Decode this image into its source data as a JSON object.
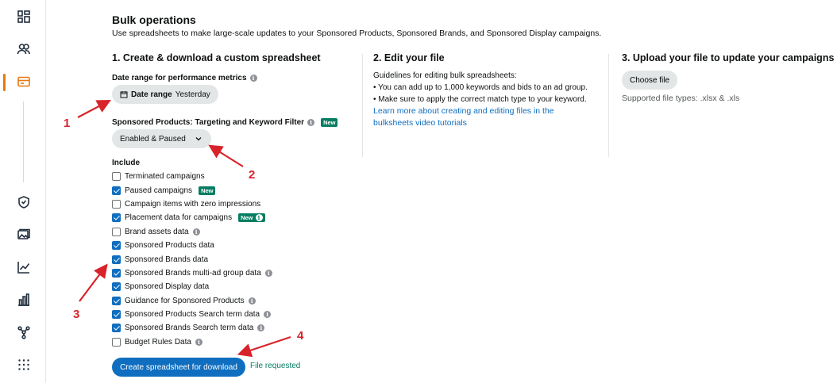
{
  "sidebar": {
    "icons": [
      "dashboard-icon",
      "audiences-icon",
      "campaigns-icon",
      "brand-safety-icon",
      "media-icon",
      "reports-icon",
      "measurement-icon",
      "integrations-icon",
      "apps-grid-icon"
    ],
    "active_index": 2,
    "accent_color": "#e47911"
  },
  "header": {
    "title": "Bulk operations",
    "subtitle": "Use spreadsheets to make large-scale updates to your Sponsored Products, Sponsored Brands, and Sponsored Display campaigns."
  },
  "step1": {
    "title": "1. Create & download a custom spreadsheet",
    "date_range_label": "Date range for performance metrics",
    "date_range_button_bold": "Date range",
    "date_range_value": "Yesterday",
    "filter_label": "Sponsored Products: Targeting and Keyword Filter",
    "filter_badge": "New",
    "filter_value": "Enabled & Paused",
    "include_title": "Include",
    "include_items": [
      {
        "label": "Terminated campaigns",
        "checked": false,
        "badge": "",
        "info": false
      },
      {
        "label": "Paused campaigns",
        "checked": true,
        "badge": "New",
        "info": false
      },
      {
        "label": "Campaign items with zero impressions",
        "checked": false,
        "badge": "",
        "info": false
      },
      {
        "label": "Placement data for campaigns",
        "checked": true,
        "badge": "New",
        "info": true
      },
      {
        "label": "Brand assets data",
        "checked": false,
        "badge": "",
        "info": true
      },
      {
        "label": "Sponsored Products data",
        "checked": true,
        "badge": "",
        "info": false
      },
      {
        "label": "Sponsored Brands data",
        "checked": true,
        "badge": "",
        "info": false
      },
      {
        "label": "Sponsored Brands multi-ad group data",
        "checked": true,
        "badge": "",
        "info": true
      },
      {
        "label": "Sponsored Display data",
        "checked": true,
        "badge": "",
        "info": false
      },
      {
        "label": "Guidance for Sponsored Products",
        "checked": true,
        "badge": "",
        "info": true
      },
      {
        "label": "Sponsored Products Search term data",
        "checked": true,
        "badge": "",
        "info": true
      },
      {
        "label": "Sponsored Brands Search term data",
        "checked": true,
        "badge": "",
        "info": true
      },
      {
        "label": "Budget Rules Data",
        "checked": false,
        "badge": "",
        "info": true
      }
    ],
    "create_button": "Create spreadsheet for download",
    "status": "File requested"
  },
  "step2": {
    "title": "2. Edit your file",
    "guidelines_heading": "Guidelines for editing bulk spreadsheets:",
    "bullet1": "• You can add up to 1,000 keywords and bids to an ad group.",
    "bullet2": "• Make sure to apply the correct match type to your keyword.",
    "link_text": "Learn more about creating and editing files in the bulksheets video tutorials"
  },
  "step3": {
    "title": "3. Upload your file to update your campaigns",
    "choose_file": "Choose file",
    "supported_types": "Supported file types: .xlsx & .xls"
  },
  "annotations": {
    "numbers": [
      "1",
      "2",
      "3",
      "4"
    ],
    "color": "#d8232a"
  },
  "colors": {
    "primary": "#0f6ebf",
    "success": "#067d62",
    "badge": "#067d62"
  }
}
